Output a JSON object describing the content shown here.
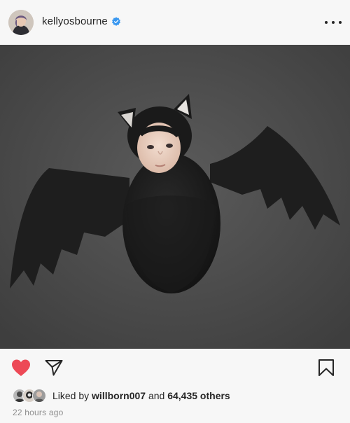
{
  "post": {
    "username": "kellyosbourne",
    "verified": true,
    "more_icon": "more-horizontal-icon"
  },
  "photo": {
    "subject": "baby in black bat costume on dark gray blanket"
  },
  "actions": {
    "like_icon": "heart-filled-icon",
    "share_icon": "paper-plane-icon",
    "save_icon": "bookmark-icon",
    "like_color": "#ed4956"
  },
  "likes": {
    "prefix": "Liked by",
    "first_liker": "willborn007",
    "conjunction": "and",
    "others": "64,435 others"
  },
  "timestamp": "22 hours ago"
}
